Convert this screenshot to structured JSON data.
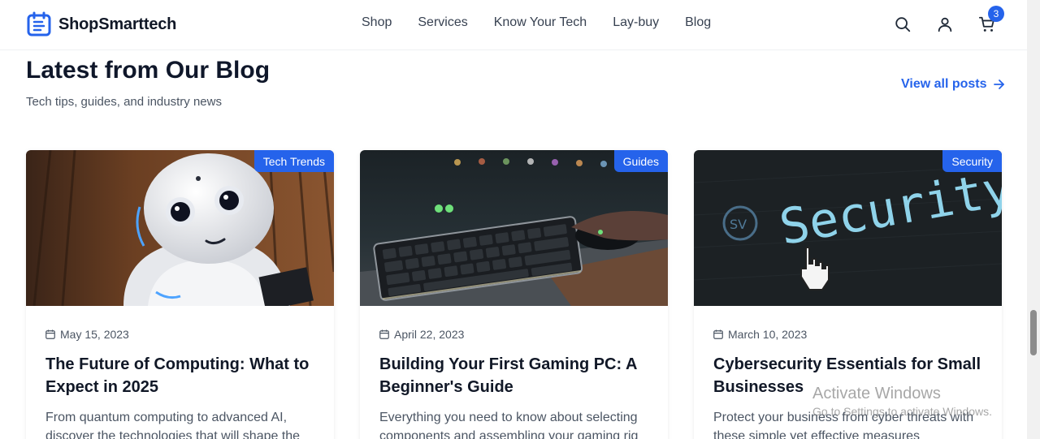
{
  "header": {
    "brand": "ShopSmarttech",
    "nav": [
      "Shop",
      "Services",
      "Know Your Tech",
      "Lay-buy",
      "Blog"
    ],
    "cart_count": "3",
    "icons": [
      "search-icon",
      "user-icon",
      "cart-icon"
    ]
  },
  "section": {
    "title": "Latest from Our Blog",
    "subtitle": "Tech tips, guides, and industry news",
    "view_all": "View all posts"
  },
  "cards": [
    {
      "tag": "Tech Trends",
      "date": "May 15, 2023",
      "title": "The Future of Computing: What to Expect in 2025",
      "excerpt": "From quantum computing to advanced AI, discover the technologies that will shape the"
    },
    {
      "tag": "Guides",
      "date": "April 22, 2023",
      "title": "Building Your First Gaming PC: A Beginner's Guide",
      "excerpt": "Everything you need to know about selecting components and assembling your gaming rig"
    },
    {
      "tag": "Security",
      "date": "March 10, 2023",
      "title": "Cybersecurity Essentials for Small Businesses",
      "excerpt": "Protect your business from cyber threats with these simple yet effective measures",
      "image_text": "Security"
    }
  ],
  "watermark": {
    "title": "Activate Windows",
    "subtitle": "Go to Settings to activate Windows."
  },
  "colors": {
    "accent": "#2563eb",
    "text": "#111827",
    "muted": "#4b5563"
  }
}
